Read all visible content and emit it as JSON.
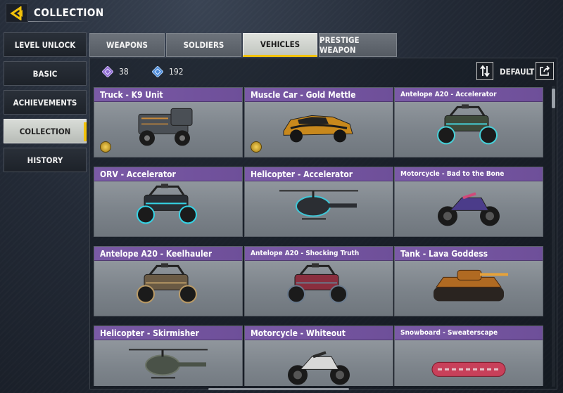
{
  "header": {
    "title": "COLLECTION",
    "back_icon": "back-arrow-icon",
    "accent_color": "#f2c20a"
  },
  "nav": {
    "items": [
      {
        "label": "LEVEL UNLOCK",
        "active": false
      },
      {
        "label": "BASIC",
        "active": false
      },
      {
        "label": "ACHIEVEMENTS",
        "active": false
      },
      {
        "label": "COLLECTION",
        "active": true
      },
      {
        "label": "HISTORY",
        "active": false
      }
    ]
  },
  "tabs": [
    {
      "label": "WEAPONS",
      "active": false
    },
    {
      "label": "SOLDIERS",
      "active": false
    },
    {
      "label": "VEHICLES",
      "active": true
    },
    {
      "label": "PRESTIGE WEAPON",
      "active": false
    }
  ],
  "currency": [
    {
      "icon": "purple-diamond-icon",
      "value": "38",
      "color": "#8e6cd1"
    },
    {
      "icon": "blue-diamond-icon",
      "value": "192",
      "color": "#4c8ad8"
    }
  ],
  "sort": {
    "label": "DEFAULT",
    "icon": "sort-arrows-icon",
    "share_icon": "share-export-icon"
  },
  "card_header_color": "#7a5aa6",
  "vehicles": [
    {
      "name": "Truck - K9 Unit",
      "small": false,
      "badge": true,
      "kind": "truck",
      "color": "#4a4f55",
      "accent": "#c98a3a"
    },
    {
      "name": "Muscle Car - Gold Mettle",
      "small": false,
      "badge": true,
      "kind": "car",
      "color": "#c8881c",
      "accent": "#1a1a1a"
    },
    {
      "name": "Antelope A20 - Accelerator",
      "small": true,
      "badge": false,
      "kind": "buggy",
      "color": "#3e4a3a",
      "accent": "#46d0d8"
    },
    {
      "name": "ORV - Accelerator",
      "small": false,
      "badge": false,
      "kind": "buggy",
      "color": "#2a2e34",
      "accent": "#35d4e6"
    },
    {
      "name": "Helicopter - Accelerator",
      "small": false,
      "badge": false,
      "kind": "heli",
      "color": "#2b2e33",
      "accent": "#3fc6d6"
    },
    {
      "name": "Motorcycle - Bad to the Bone",
      "small": true,
      "badge": false,
      "kind": "moto",
      "color": "#4b3c8a",
      "accent": "#d04a7a"
    },
    {
      "name": "Antelope A20 - Keelhauler",
      "small": false,
      "badge": false,
      "kind": "buggy",
      "color": "#6a5a44",
      "accent": "#b99a66"
    },
    {
      "name": "Antelope A20 - Shocking Truth",
      "small": true,
      "badge": false,
      "kind": "buggy",
      "color": "#8a2e3e",
      "accent": "#6a7a8c"
    },
    {
      "name": "Tank - Lava Goddess",
      "small": false,
      "badge": false,
      "kind": "tank",
      "color": "#b06a22",
      "accent": "#e6a23a"
    },
    {
      "name": "Helicopter - Skirmisher",
      "small": false,
      "badge": false,
      "kind": "heli",
      "color": "#4a5248",
      "accent": "#6c7468"
    },
    {
      "name": "Motorcycle - Whiteout",
      "small": false,
      "badge": false,
      "kind": "moto",
      "color": "#d8d8d8",
      "accent": "#2a2a2a"
    },
    {
      "name": "Snowboard - Sweaterscape",
      "small": true,
      "badge": false,
      "kind": "board",
      "color": "#c8405a",
      "accent": "#e4c2c8"
    }
  ]
}
